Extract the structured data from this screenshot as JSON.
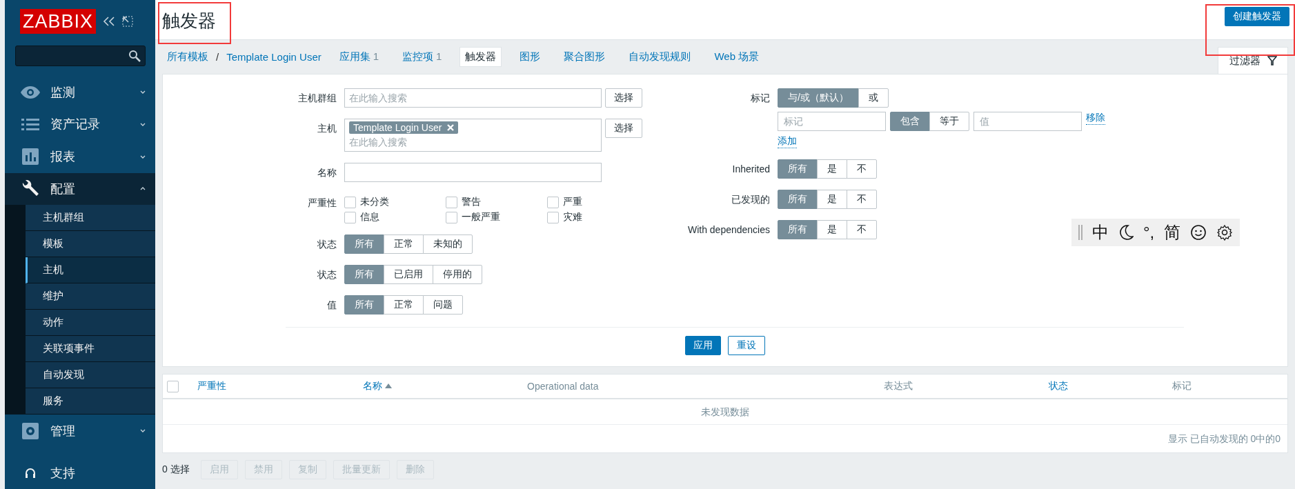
{
  "sidebar": {
    "logo": "ZABBIX",
    "menu": [
      {
        "label": "监测",
        "expanded": false
      },
      {
        "label": "资产记录",
        "expanded": false
      },
      {
        "label": "报表",
        "expanded": false
      },
      {
        "label": "配置",
        "expanded": true,
        "children": [
          {
            "label": "主机群组",
            "selected": false
          },
          {
            "label": "模板",
            "selected": false
          },
          {
            "label": "主机",
            "selected": true
          },
          {
            "label": "维护",
            "selected": false
          },
          {
            "label": "动作",
            "selected": false
          },
          {
            "label": "关联项事件",
            "selected": false
          },
          {
            "label": "自动发现",
            "selected": false
          },
          {
            "label": "服务",
            "selected": false
          }
        ]
      },
      {
        "label": "管理",
        "expanded": false
      }
    ],
    "support": "支持"
  },
  "page": {
    "title": "触发器",
    "highlighted": true
  },
  "create_button": {
    "label": "创建触发器",
    "highlighted": true
  },
  "breadcrumbs": [
    {
      "label": "所有模板"
    },
    {
      "label": "Template Login User"
    }
  ],
  "breadcrumb_separator": "/",
  "nav_tabs": [
    {
      "label": "应用集",
      "count": "1",
      "selected": false
    },
    {
      "label": "监控项",
      "count": "1",
      "selected": false
    },
    {
      "label": "触发器",
      "selected": true
    },
    {
      "label": "图形",
      "selected": false
    },
    {
      "label": "聚合图形",
      "selected": false
    },
    {
      "label": "自动发现规则",
      "selected": false
    },
    {
      "label": "Web 场景",
      "selected": false
    }
  ],
  "filter_tab": {
    "label": "过滤器",
    "selected": true
  },
  "filter": {
    "left": [
      {
        "kind": "multiselect",
        "label": "主机群组",
        "placeholder": "在此输入搜索",
        "button": "选择"
      },
      {
        "kind": "multiselect",
        "label": "主机",
        "chips": [
          "Template Login User"
        ],
        "placeholder": "在此输入搜索",
        "button": "选择"
      },
      {
        "kind": "text",
        "label": "名称"
      },
      {
        "kind": "checkboxes",
        "label": "严重性",
        "options": [
          {
            "label": "未分类",
            "checked": false
          },
          {
            "label": "警告",
            "checked": false
          },
          {
            "label": "严重",
            "checked": false
          },
          {
            "label": "信息",
            "checked": false
          },
          {
            "label": "一般严重",
            "checked": false
          },
          {
            "label": "灾难",
            "checked": false
          }
        ]
      },
      {
        "kind": "segmented",
        "label": "状态",
        "options": [
          {
            "label": "所有",
            "selected": true
          },
          {
            "label": "正常",
            "selected": false
          },
          {
            "label": "未知的",
            "selected": false
          }
        ]
      },
      {
        "kind": "segmented",
        "label": "状态",
        "options": [
          {
            "label": "所有",
            "selected": true
          },
          {
            "label": "已启用",
            "selected": false
          },
          {
            "label": "停用的",
            "selected": false
          }
        ]
      },
      {
        "kind": "segmented",
        "label": "值",
        "options": [
          {
            "label": "所有",
            "selected": true
          },
          {
            "label": "正常",
            "selected": false
          },
          {
            "label": "问题",
            "selected": false
          }
        ]
      }
    ],
    "right": [
      {
        "kind": "tags",
        "label": "标记",
        "options": [
          {
            "label": "与/或（默认）",
            "selected": true
          },
          {
            "label": "或",
            "selected": false
          }
        ],
        "tag_placeholder": "标记",
        "operators": [
          {
            "label": "包含",
            "selected": true
          },
          {
            "label": "等于",
            "selected": false
          }
        ],
        "value_placeholder": "值",
        "remove": "移除",
        "add": "添加"
      },
      {
        "kind": "segmented",
        "label": "Inherited",
        "options": [
          {
            "label": "所有",
            "selected": true
          },
          {
            "label": "是",
            "selected": false
          },
          {
            "label": "不",
            "selected": false
          }
        ]
      },
      {
        "kind": "segmented",
        "label": "已发现的",
        "options": [
          {
            "label": "所有",
            "selected": true
          },
          {
            "label": "是",
            "selected": false
          },
          {
            "label": "不",
            "selected": false
          }
        ]
      },
      {
        "kind": "segmented",
        "label": "With dependencies",
        "options": [
          {
            "label": "所有",
            "selected": true
          },
          {
            "label": "是",
            "selected": false
          },
          {
            "label": "不",
            "selected": false
          }
        ]
      }
    ],
    "apply": "应用",
    "reset": "重设"
  },
  "ime_toolbar": {
    "mode": "中",
    "punctuation": "°,",
    "script": "简"
  },
  "table": {
    "select_all": {
      "checked": false
    },
    "columns": [
      {
        "label": "严重性",
        "sortable": true
      },
      {
        "label": "名称",
        "sortable": true,
        "sorted": true
      },
      {
        "label": "Operational data",
        "sortable": false
      },
      {
        "label": "表达式",
        "sortable": false
      },
      {
        "label": "状态",
        "sortable": true
      },
      {
        "label": "标记",
        "sortable": false
      }
    ],
    "empty": "未发现数据",
    "footer": "显示 已自动发现的 0中的0"
  },
  "actions": {
    "selected_count": "0 选择",
    "buttons": [
      {
        "label": "启用",
        "disabled": true
      },
      {
        "label": "禁用",
        "disabled": true
      },
      {
        "label": "复制",
        "disabled": true
      },
      {
        "label": "批量更新",
        "disabled": true
      },
      {
        "label": "删除",
        "disabled": true
      }
    ]
  }
}
